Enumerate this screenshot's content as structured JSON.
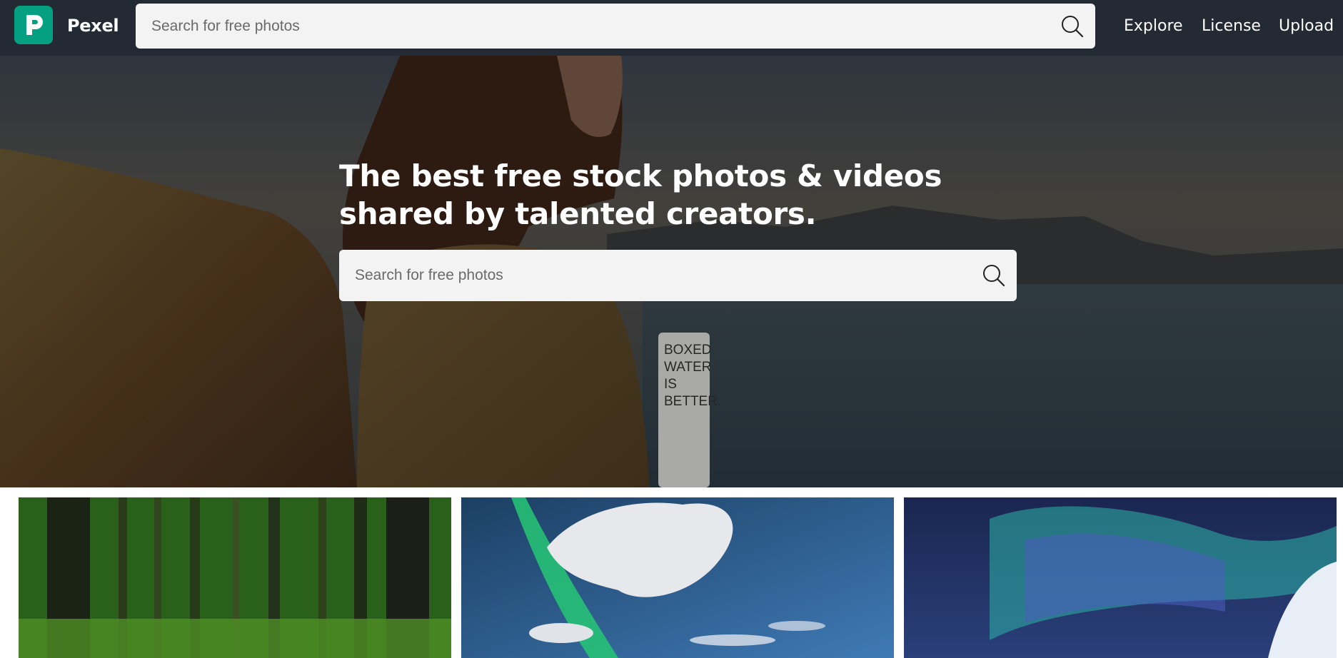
{
  "header": {
    "brand": "Pexel",
    "search_placeholder": "Search for free photos",
    "nav": [
      {
        "label": "Explore"
      },
      {
        "label": "License"
      },
      {
        "label": "Upload"
      }
    ]
  },
  "hero": {
    "title": "The best free stock photos & videos shared by talented creators.",
    "search_placeholder": "Search for free photos",
    "bottle_text": [
      "BOXED",
      "WATER",
      "IS",
      "BETTER."
    ]
  },
  "icons": {
    "logo": "pexel-logo-icon",
    "search": "search-icon"
  },
  "colors": {
    "header_bg": "#232a34",
    "brand_green": "#05a081",
    "search_bg": "#f3f3f3"
  },
  "photos": [
    {
      "subject": "green-forest"
    },
    {
      "subject": "green-aurora-sky"
    },
    {
      "subject": "blue-aurora-snow"
    }
  ]
}
